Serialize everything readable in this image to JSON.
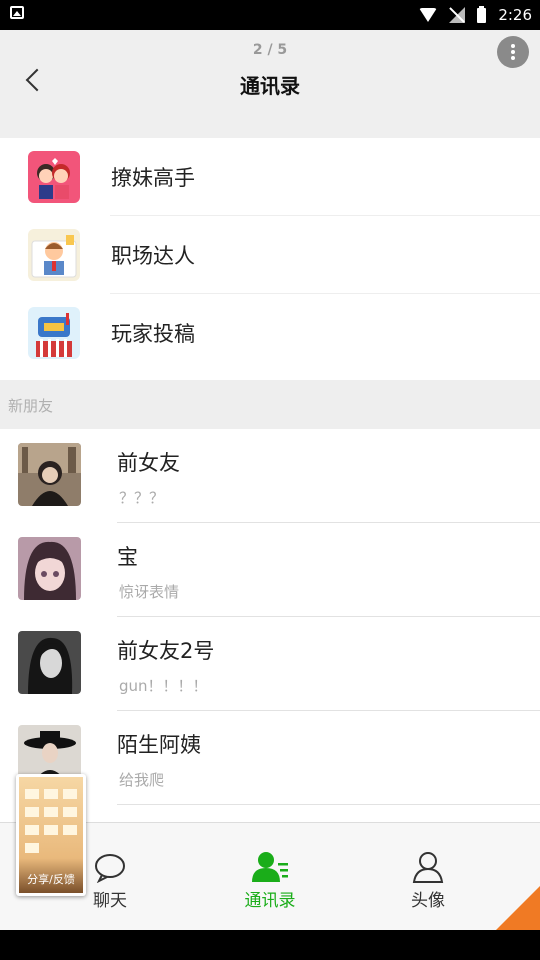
{
  "status": {
    "time": "2:26"
  },
  "header": {
    "page_indicator": "2 / 5",
    "title": "通讯录"
  },
  "top_items": [
    {
      "label": "撩妹高手",
      "icon": "couple-icon"
    },
    {
      "label": "职场达人",
      "icon": "office-worker-icon"
    },
    {
      "label": "玩家投稿",
      "icon": "mailbox-icon"
    }
  ],
  "section": {
    "label": "新朋友"
  },
  "friends": [
    {
      "name": "前女友",
      "message": "？？？"
    },
    {
      "name": "宝",
      "message": "惊讶表情"
    },
    {
      "name": "前女友2号",
      "message": "gun！！！！"
    },
    {
      "name": "陌生阿姨",
      "message": "给我爬"
    }
  ],
  "tabs": [
    {
      "label": "聊天",
      "icon": "chat-bubble-icon"
    },
    {
      "label": "通讯录",
      "icon": "contacts-icon",
      "active": true
    },
    {
      "label": "头像",
      "icon": "person-icon"
    }
  ],
  "floating": {
    "caption": "分享/反馈"
  },
  "colors": {
    "accent": "#1aad19",
    "corner": "#f07a24"
  }
}
